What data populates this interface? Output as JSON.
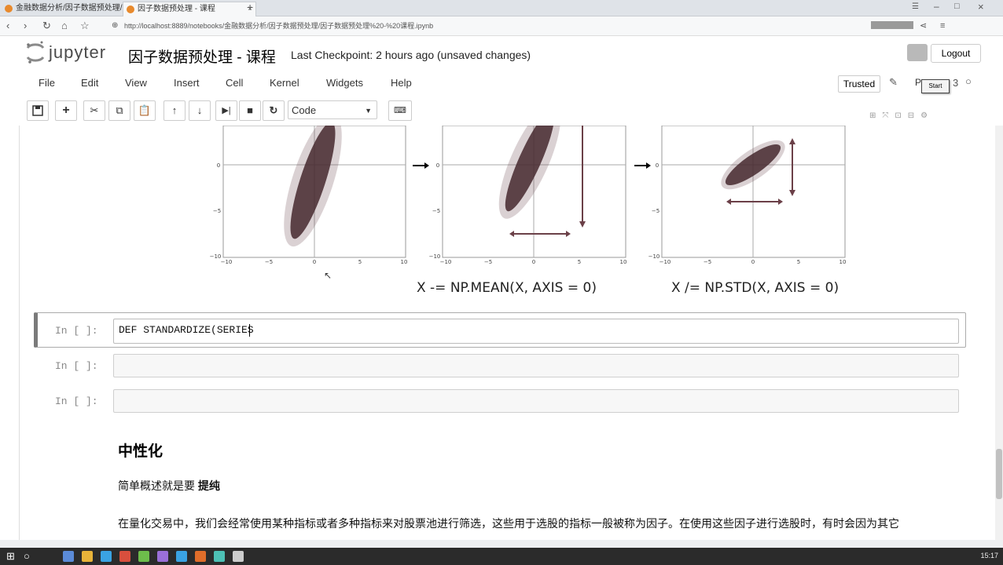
{
  "browser": {
    "tabs": [
      {
        "label": "金融数据分析/因子数据预处理/"
      },
      {
        "label": "因子数据预处理 - 课程"
      }
    ],
    "url": "http://localhost:8889/notebooks/金融数据分析/因子数据预处理/因子数据预处理%20-%20课程.ipynb"
  },
  "header": {
    "logo_text": "jupyter",
    "notebook_name": "因子数据预处理 - 课程",
    "checkpoint": "Last Checkpoint: 2 hours ago (unsaved changes)",
    "logout": "Logout",
    "start_tooltip": "Start"
  },
  "menu": [
    "File",
    "Edit",
    "View",
    "Insert",
    "Cell",
    "Kernel",
    "Widgets",
    "Help"
  ],
  "status": {
    "trusted": "Trusted",
    "kernel_num": "3"
  },
  "toolbar": {
    "cell_type": "Code",
    "buttons": [
      "save-icon",
      "plus-icon",
      "cut-icon",
      "copy-icon",
      "paste-icon",
      "arrow-up-icon",
      "arrow-down-icon",
      "step-forward-icon",
      "stop-icon",
      "restart-icon",
      "keyboard-icon"
    ]
  },
  "figure": {
    "panels": [
      {
        "x_ticks": [
          "−10",
          "−5",
          "0",
          "5",
          "10"
        ],
        "y_ticks": [
          "0",
          "−5",
          "−10"
        ]
      },
      {
        "x_ticks": [
          "−10",
          "−5",
          "0",
          "5",
          "10"
        ],
        "y_ticks": [
          "0",
          "−5",
          "−10"
        ]
      },
      {
        "x_ticks": [
          "−10",
          "−5",
          "0",
          "5",
          "10"
        ],
        "y_ticks": [
          "0",
          "−5",
          "−10"
        ]
      }
    ],
    "formula_center": "X -= NP.MEAN(X, AXIS = 0)",
    "formula_scale": "X /= NP.STD(X, AXIS = 0)"
  },
  "cells": [
    {
      "prompt": "In  [  ]:",
      "code": "DEF STANDARDIZE(SERIES"
    },
    {
      "prompt": "In  [  ]:",
      "code": ""
    },
    {
      "prompt": "In  [  ]:",
      "code": ""
    }
  ],
  "markdown": {
    "heading": "中性化",
    "p1_prefix": "简单概述就是要 ",
    "p1_bold": "提纯",
    "p2": "在量化交易中，我们会经常使用某种指标或者多种指标来对股票池进行筛选，这些用于选股的指标一般被称为因子。在使用这些因子进行选股时，有时会因为其它"
  },
  "taskbar": {
    "clock": "15:17"
  }
}
